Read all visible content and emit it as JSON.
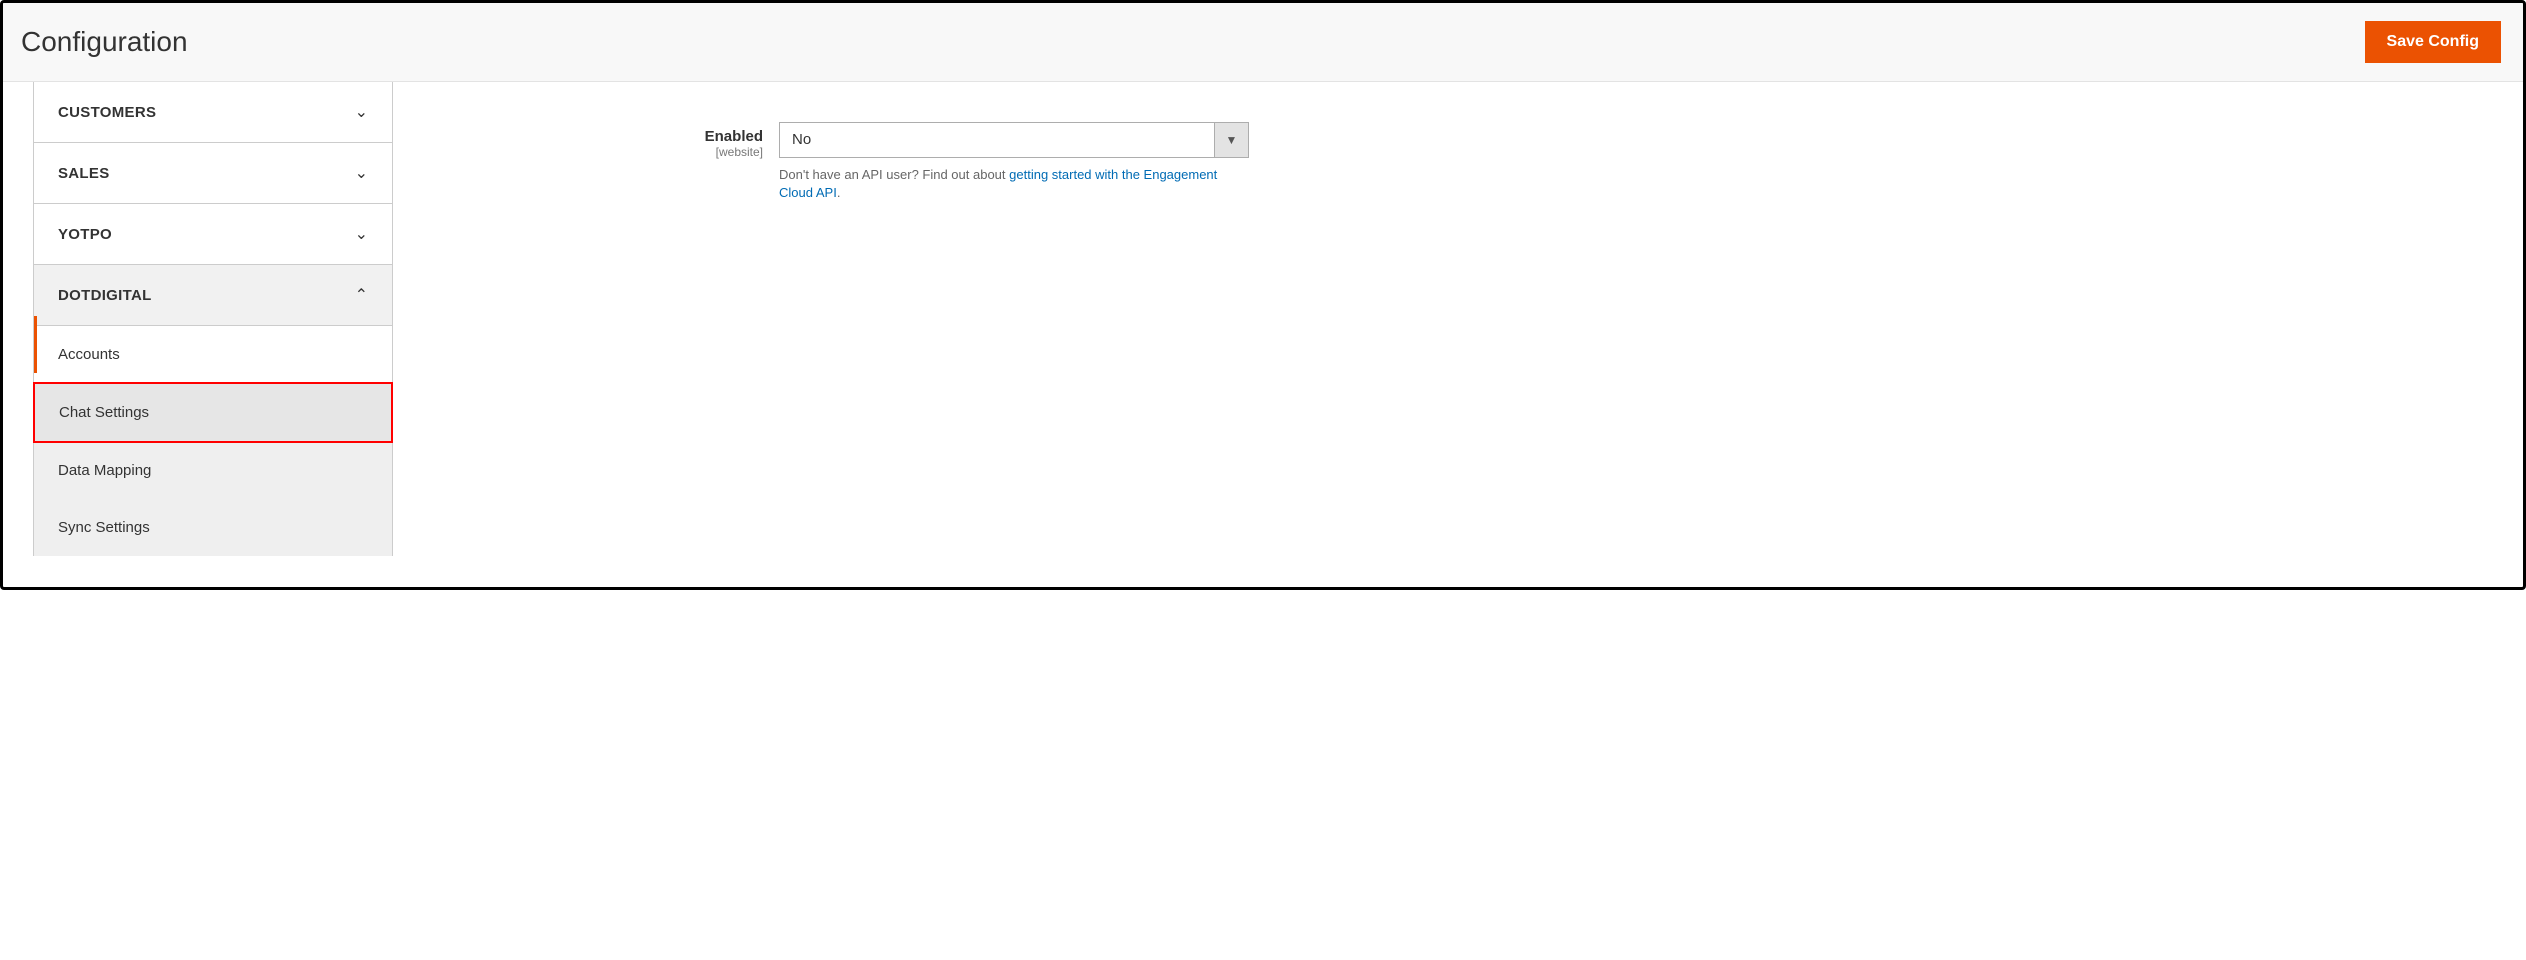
{
  "header": {
    "title": "Configuration",
    "save_label": "Save Config"
  },
  "sidebar": {
    "tabs": [
      {
        "label": "CUSTOMERS",
        "expanded": false
      },
      {
        "label": "SALES",
        "expanded": false
      },
      {
        "label": "YOTPO",
        "expanded": false
      },
      {
        "label": "DOTDIGITAL",
        "expanded": true
      }
    ],
    "dotdigital_subtabs": [
      {
        "label": "Accounts"
      },
      {
        "label": "Chat Settings"
      },
      {
        "label": "Data Mapping"
      },
      {
        "label": "Sync Settings"
      }
    ]
  },
  "main": {
    "enabled_field": {
      "label": "Enabled",
      "scope": "[website]",
      "value": "No",
      "help_prefix": "Don't have an API user? Find out about ",
      "help_link": "getting started with the Engagement Cloud API",
      "help_suffix": "."
    }
  }
}
